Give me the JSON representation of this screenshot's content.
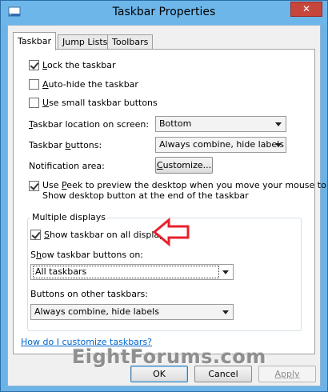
{
  "window": {
    "title": "Taskbar Properties",
    "close_glyph": "✕"
  },
  "tabs": [
    {
      "label": "Taskbar",
      "active": true
    },
    {
      "label": "Jump Lists",
      "active": false
    },
    {
      "label": "Toolbars",
      "active": false
    }
  ],
  "taskbar": {
    "lock": {
      "pre": "",
      "u": "L",
      "post": "ock the taskbar",
      "checked": true
    },
    "autohide": {
      "pre": "",
      "u": "A",
      "post": "uto-hide the taskbar",
      "checked": false
    },
    "small_buttons": {
      "pre": "",
      "u": "U",
      "post": "se small taskbar buttons",
      "checked": false
    },
    "location": {
      "pre": "",
      "u": "T",
      "post": "askbar location on screen:",
      "value": "Bottom"
    },
    "buttons": {
      "pre": "Taskbar ",
      "u": "b",
      "post": "uttons:",
      "value": "Always combine, hide labels"
    },
    "notification": {
      "label": "Notification area:",
      "button_pre": "",
      "button_u": "C",
      "button_post": "ustomize..."
    },
    "peek": {
      "pre": "Use ",
      "u": "P",
      "post": "eek to preview the desktop when you move your mouse to the",
      "line2": "Show desktop button at the end of the taskbar",
      "checked": true
    }
  },
  "multiple_displays": {
    "title": "Multiple displays",
    "show_all": {
      "pre": "",
      "u": "S",
      "post": "how taskbar on all displays",
      "checked": true
    },
    "show_buttons_on": {
      "pre": "S",
      "u": "h",
      "post": "ow taskbar buttons on:",
      "value": "All taskbars"
    },
    "other_taskbars": {
      "label": "Buttons on other taskbars:",
      "value": "Always combine, hide labels"
    }
  },
  "help_link": "How do I customize taskbars?",
  "watermark": "EightForums.com",
  "footer": {
    "ok": "OK",
    "cancel": "Cancel",
    "apply": "Apply"
  },
  "colors": {
    "frame": "#6bb3e6",
    "close_button": "#c7463c",
    "link": "#0066cc",
    "arrow": "#e8202a"
  }
}
